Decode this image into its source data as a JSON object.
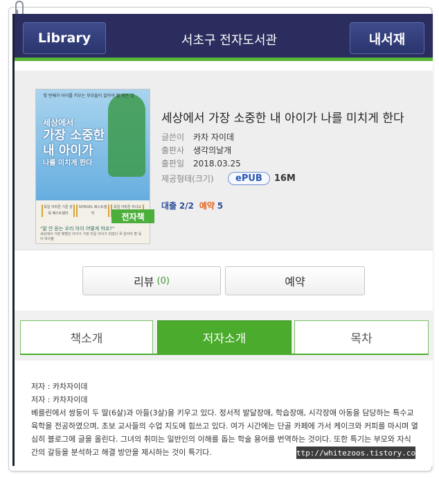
{
  "header": {
    "library_label": "Library",
    "title": "서초구 전자도서관",
    "my_shelf_label": "내서재"
  },
  "book": {
    "title": "세상에서 가장 소중한 내 아이가 나를 미치게 한다",
    "ebook_badge": "전자책",
    "cover": {
      "top_text": "첫 번째가 아이를 키우는 부모들이 알아야 할 모든 것",
      "title_line1": "세상에서",
      "title_line2": "가장 소중한",
      "title_line3": "내 아이가",
      "title_line4": "나를 미치게 한다",
      "badge1": "독일 아마존 기준 양육 베스트셀러",
      "badge2": "SPIEGEL 베스트셀러",
      "badge3": "독일 아마존 자녀교육 분야 1위",
      "quote": "\"말 안 듣는 우리 아이 어떻게 하죠?\"",
      "sub": "세상에서 가장 예뻤던 아이가 가장 미운 아이가 되었다 꼭 읽어야 할 육아 바이블"
    },
    "meta": [
      {
        "label": "글쓴이",
        "value": "카차 자이데"
      },
      {
        "label": "출판사",
        "value": "생각의날개"
      },
      {
        "label": "출판일",
        "value": "2018.03.25"
      }
    ],
    "format_label": "제공형태(크기)",
    "format": "ePUB",
    "size": "16M",
    "loan_label": "대출",
    "loan_value": "2/2",
    "reserve_label": "예약",
    "reserve_value": "5"
  },
  "actions": {
    "review_label": "리뷰",
    "review_count": "(0)",
    "reserve_label": "예약"
  },
  "tabs": [
    {
      "label": "책소개"
    },
    {
      "label": "저자소개"
    },
    {
      "label": "목차"
    }
  ],
  "content": {
    "line1": "저자 : 카차자이데",
    "line2": "저자 : 카차자이데",
    "body": "베를린에서 쌍둥이 두 딸(6살)과 아들(3살)을 키우고 있다. 정서적 발달장애, 학습장애, 시각장애 아동을 담당하는 특수교육학을 전공하였으며, 초보 교사들의 수업 지도에 힘쓰고 있다. 여가 시간에는 단골 카페에 가서 케이크와 커피를 마시며 열심히 블로그에 글을 올린다. 그녀의 취미는 일반인의 이해를 돕는 학술 용어를 번역하는 것이다. 또한 특기는 부모와 자식 간의 갈등을 분석하고 해결 방안을 제시하는 것이 특기다."
  },
  "watermark": "http://whitezoos.tistory.com",
  "colors": {
    "header_bg": "#2b2d5e",
    "accent_green": "#4aab2c",
    "reserve_orange": "#e4621f"
  }
}
